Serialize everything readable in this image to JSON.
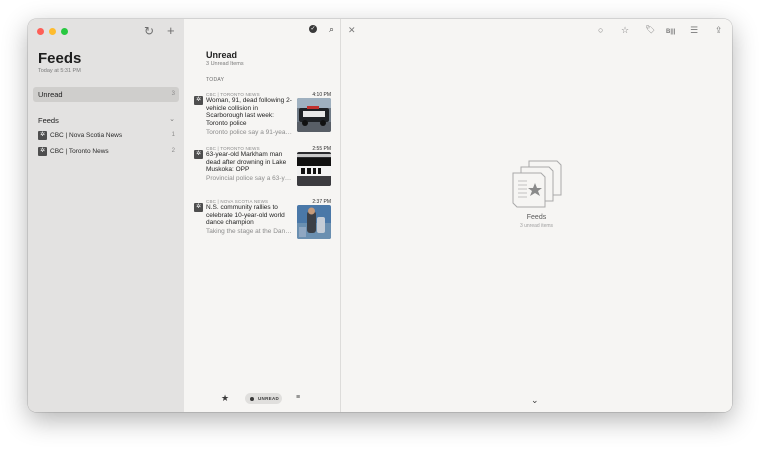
{
  "sidebar": {
    "title": "Feeds",
    "subtitle": "Today at 5:31 PM",
    "unread": {
      "label": "Unread",
      "count": "3"
    },
    "feeds_header": "Feeds",
    "feeds": [
      {
        "name": "CBC | Nova Scotia News",
        "count": "1"
      },
      {
        "name": "CBC | Toronto News",
        "count": "2"
      }
    ]
  },
  "list": {
    "title": "Unread",
    "subtitle": "3 Unread Items",
    "section": "TODAY",
    "articles": [
      {
        "source": "CBC | TORONTO NEWS",
        "time": "4:10 PM",
        "headline": "Woman, 91, dead following 2-vehicle collision in Scarborough last week: Toronto police",
        "snippet": "Toronto police say a 91-yea…"
      },
      {
        "source": "CBC | TORONTO NEWS",
        "time": "2:55 PM",
        "headline": "63-year-old Markham man dead after drowning in Lake Muskoka: OPP",
        "snippet": "Provincial police say a 63-y…"
      },
      {
        "source": "CBC | NOVA SCOTIA NEWS",
        "time": "2:37 PM",
        "headline": "N.S. community rallies to celebrate 10-year-old world dance champion",
        "snippet": "Taking the stage at the Dan…"
      }
    ],
    "filter_label": "UNREAD"
  },
  "reader": {
    "placeholder_title": "Feeds",
    "placeholder_subtitle": "3 unread items"
  },
  "icons": {
    "close": "close-icon",
    "circle": "mark-read-icon",
    "star": "star-icon",
    "tag": "tag-icon",
    "reader_view": "reader-view-icon",
    "list": "list-icon",
    "share": "share-icon"
  },
  "colors": {
    "close": "#fe5f57",
    "minimize": "#febc2e",
    "zoom": "#28c840",
    "sidebar": "#e3e2e1",
    "selection": "#cfcecc"
  }
}
